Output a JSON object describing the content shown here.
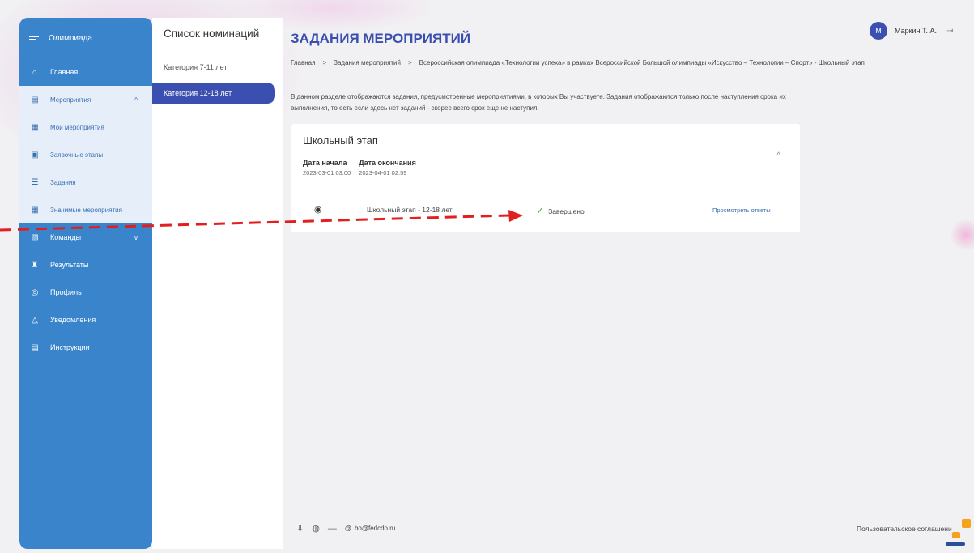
{
  "sidebar": {
    "brand": "Олимпиада",
    "items": [
      {
        "label": "Главная",
        "icon": "home-icon"
      },
      {
        "label": "Мероприятия",
        "icon": "calendar-icon"
      },
      {
        "label": "Мои мероприятия",
        "icon": "calendar-icon"
      },
      {
        "label": "Заявочные этапы",
        "icon": "form-icon"
      },
      {
        "label": "Задания",
        "icon": "list-icon"
      },
      {
        "label": "Значимые мероприятия",
        "icon": "calendar-star-icon"
      },
      {
        "label": "Команды",
        "icon": "team-icon"
      },
      {
        "label": "Результаты",
        "icon": "trophy-icon"
      },
      {
        "label": "Профиль",
        "icon": "profile-icon"
      },
      {
        "label": "Уведомления",
        "icon": "bell-icon"
      },
      {
        "label": "Инструкции",
        "icon": "document-icon"
      }
    ]
  },
  "nominations": {
    "title": "Список номинаций",
    "items": [
      "Категория 7-11 лет",
      "Категория 12-18 лет"
    ],
    "active_index": 1
  },
  "main": {
    "title": "ЗАДАНИЯ МЕРОПРИЯТИЙ",
    "breadcrumb": [
      "Главная",
      "Задания мероприятий",
      "Всероссийская олимпиада «Технологии успеха» в рамках Всероссийской Большой олимпиады «Искусство – Технологии – Спорт» - Школьный этап"
    ],
    "breadcrumb_separator": ">",
    "description": "В данном разделе отображаются задания, предусмотренные мероприятиями, в которых Вы участвуете. Задания отображаются только после наступления срока их выполнения, то есть если здесь нет заданий - скорее всего срок еще не наступил."
  },
  "stage": {
    "title": "Школьный этап",
    "start_label": "Дата начала",
    "start_value": "2023-03-01 03:00",
    "end_label": "Дата окончания",
    "end_value": "2023-04-01 02:59",
    "task_name": "Школьный этап - 12-18 лет",
    "status": "Завершено",
    "view_link": "Просмотреть ответы"
  },
  "user": {
    "initial": "М",
    "name": "Маркин Т. А."
  },
  "footer": {
    "separator": "—",
    "email_symbol": "@",
    "email": "bo@fedcdo.ru",
    "agreement": "Пользовательское соглашение"
  },
  "colors": {
    "sidebar": "#3a84cb",
    "accent": "#3b4fb0",
    "annotation_arrow": "#e21f1f",
    "status_ok": "#4caf50"
  }
}
